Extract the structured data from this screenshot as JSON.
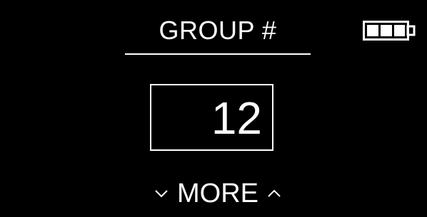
{
  "header": {
    "title": "GROUP #",
    "battery_icon": "battery-full-icon",
    "battery_level": 1.0
  },
  "main": {
    "group_number": "12"
  },
  "footer": {
    "more_label": "MORE",
    "down_icon": "chevron-down-icon",
    "up_icon": "chevron-up-icon"
  },
  "colors": {
    "background": "#000000",
    "foreground": "#ffffff"
  }
}
